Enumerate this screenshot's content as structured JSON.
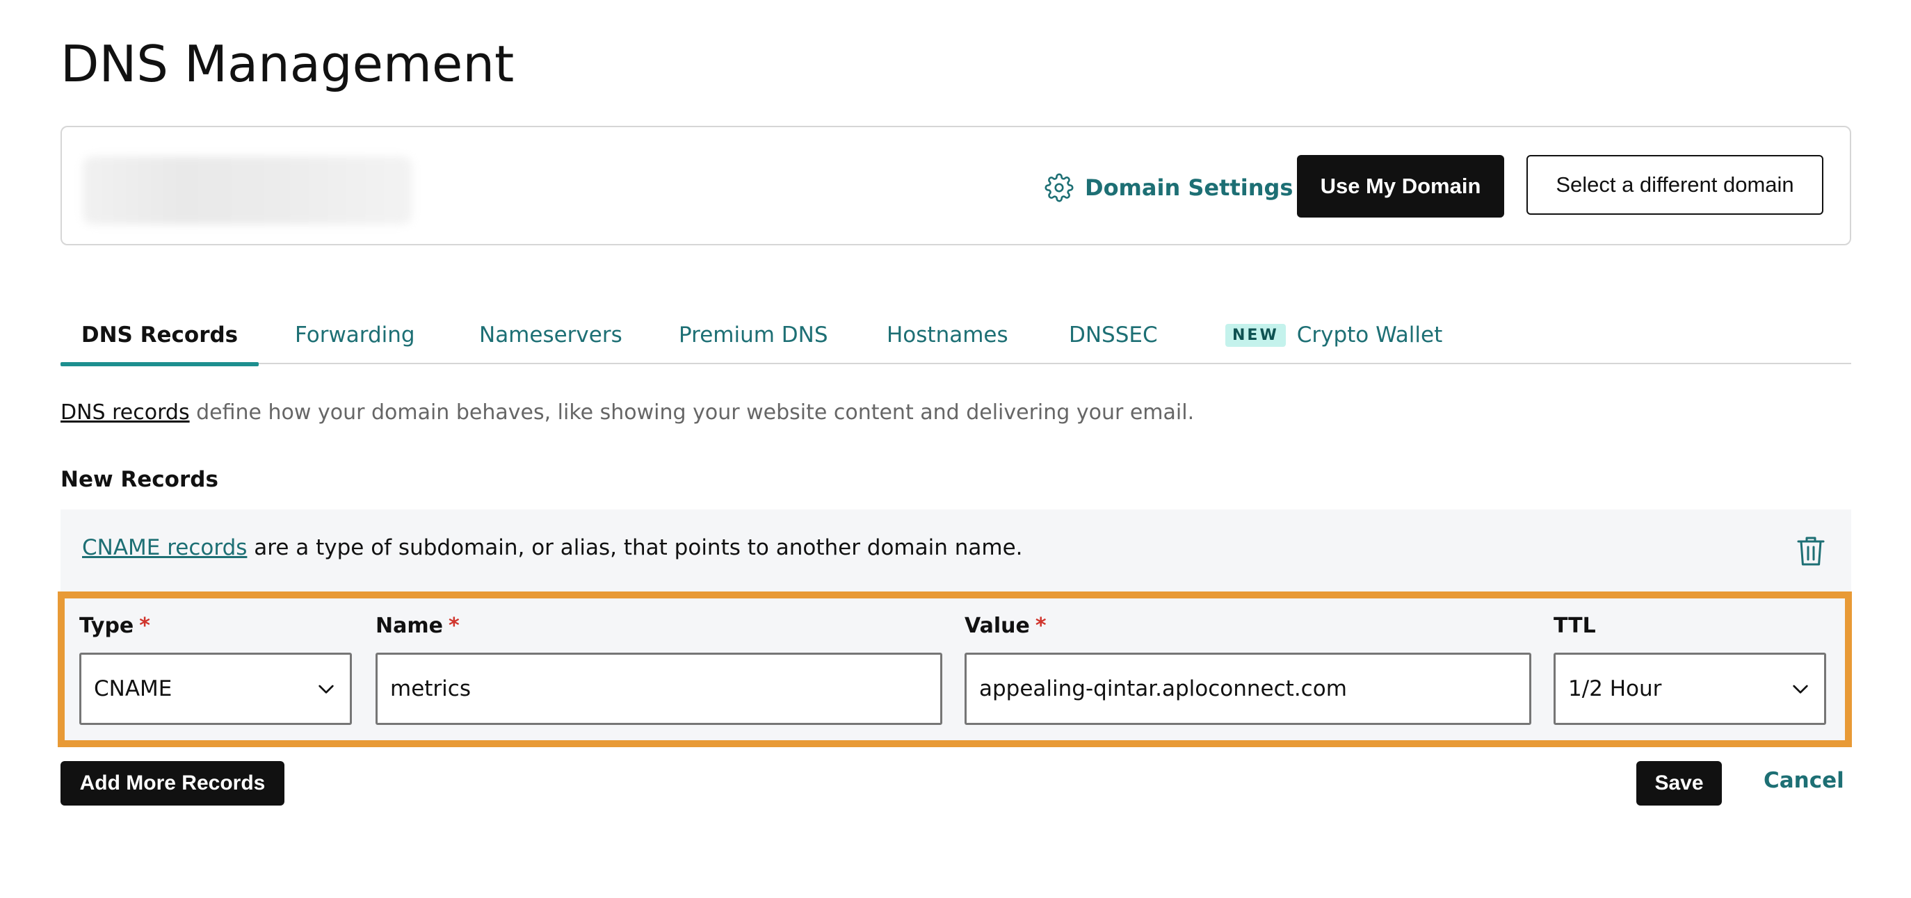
{
  "page": {
    "title": "DNS Management"
  },
  "domain_bar": {
    "domain_settings_label": "Domain Settings",
    "use_my_domain_label": "Use My Domain",
    "select_different_label": "Select a different domain"
  },
  "tabs": [
    {
      "label": "DNS Records",
      "active": true
    },
    {
      "label": "Forwarding"
    },
    {
      "label": "Nameservers"
    },
    {
      "label": "Premium DNS"
    },
    {
      "label": "Hostnames"
    },
    {
      "label": "DNSSEC"
    },
    {
      "label": "Crypto Wallet",
      "badge": "NEW"
    }
  ],
  "intro": {
    "link_text": "DNS records",
    "rest_text": " define how your domain behaves, like showing your website content and delivering your email."
  },
  "new_records": {
    "title": "New Records",
    "info_link": "CNAME records",
    "info_text": " are a type of subdomain, or alias, that points to another domain name.",
    "fields": {
      "type": {
        "label": "Type",
        "required_mark": "*",
        "value": "CNAME"
      },
      "name": {
        "label": "Name",
        "required_mark": "*",
        "value": "metrics"
      },
      "value": {
        "label": "Value",
        "required_mark": "*",
        "value": "appealing-qintar.aploconnect.com"
      },
      "ttl": {
        "label": "TTL",
        "value": "1/2 Hour"
      }
    }
  },
  "actions": {
    "add_more_label": "Add More Records",
    "save_label": "Save",
    "cancel_label": "Cancel"
  },
  "colors": {
    "accent_teal": "#1d6f74",
    "highlight_orange": "#e89a36",
    "required_red": "#d0342c"
  }
}
